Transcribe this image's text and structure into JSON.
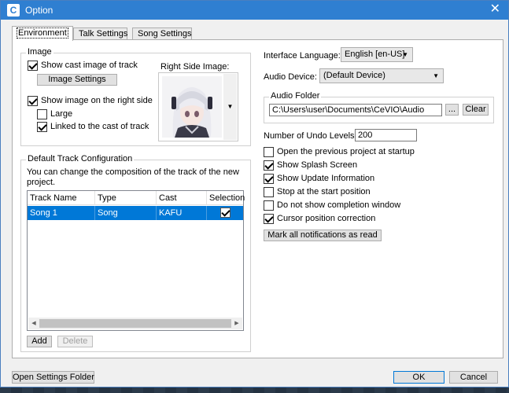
{
  "window": {
    "title": "Option",
    "app_icon": "C",
    "close_glyph": "✕"
  },
  "tabs": [
    {
      "label": "Environment",
      "active": true
    },
    {
      "label": "Talk Settings",
      "active": false
    },
    {
      "label": "Song Settings",
      "active": false
    }
  ],
  "image_group": {
    "title": "Image",
    "show_cast_image": {
      "label": "Show cast image of track",
      "checked": true
    },
    "image_settings_button": "Image Settings",
    "right_side_label": "Right Side Image:",
    "show_image_right": {
      "label": "Show image on the right side",
      "checked": true
    },
    "large": {
      "label": "Large",
      "checked": false
    },
    "linked": {
      "label": "Linked to the cast of track",
      "checked": true
    }
  },
  "track_group": {
    "title": "Default Track Configuration",
    "description": "You can change the composition of the track of the new project.",
    "columns": [
      "Track Name",
      "Type",
      "Cast",
      "Selection"
    ],
    "rows": [
      {
        "track_name": "Song 1",
        "type": "Song",
        "cast": "KAFU",
        "selected": true
      }
    ],
    "add_button": "Add",
    "delete_button": "Delete"
  },
  "right_panel": {
    "interface_language_label": "Interface Language:",
    "interface_language_value": "English [en-US]",
    "audio_device_label": "Audio Device:",
    "audio_device_value": "(Default Device)",
    "audio_folder_title": "Audio Folder",
    "audio_folder_path": "C:\\Users\\user\\Documents\\CeVIO\\Audio",
    "browse_button": "...",
    "clear_button": "Clear",
    "undo_label": "Number of Undo Levels:",
    "undo_value": "200",
    "options": [
      {
        "label": "Open the previous project at startup",
        "checked": false
      },
      {
        "label": "Show Splash Screen",
        "checked": true
      },
      {
        "label": "Show Update Information",
        "checked": true
      },
      {
        "label": "Stop at the start position",
        "checked": false
      },
      {
        "label": "Do not show completion window",
        "checked": false
      },
      {
        "label": "Cursor position correction",
        "checked": true
      }
    ],
    "mark_read_button": "Mark all notifications as read"
  },
  "footer": {
    "open_settings_button": "Open Settings Folder",
    "ok_button": "OK",
    "cancel_button": "Cancel"
  },
  "colors": {
    "titlebar": "#2f7fd1",
    "selection": "#0078d7"
  }
}
